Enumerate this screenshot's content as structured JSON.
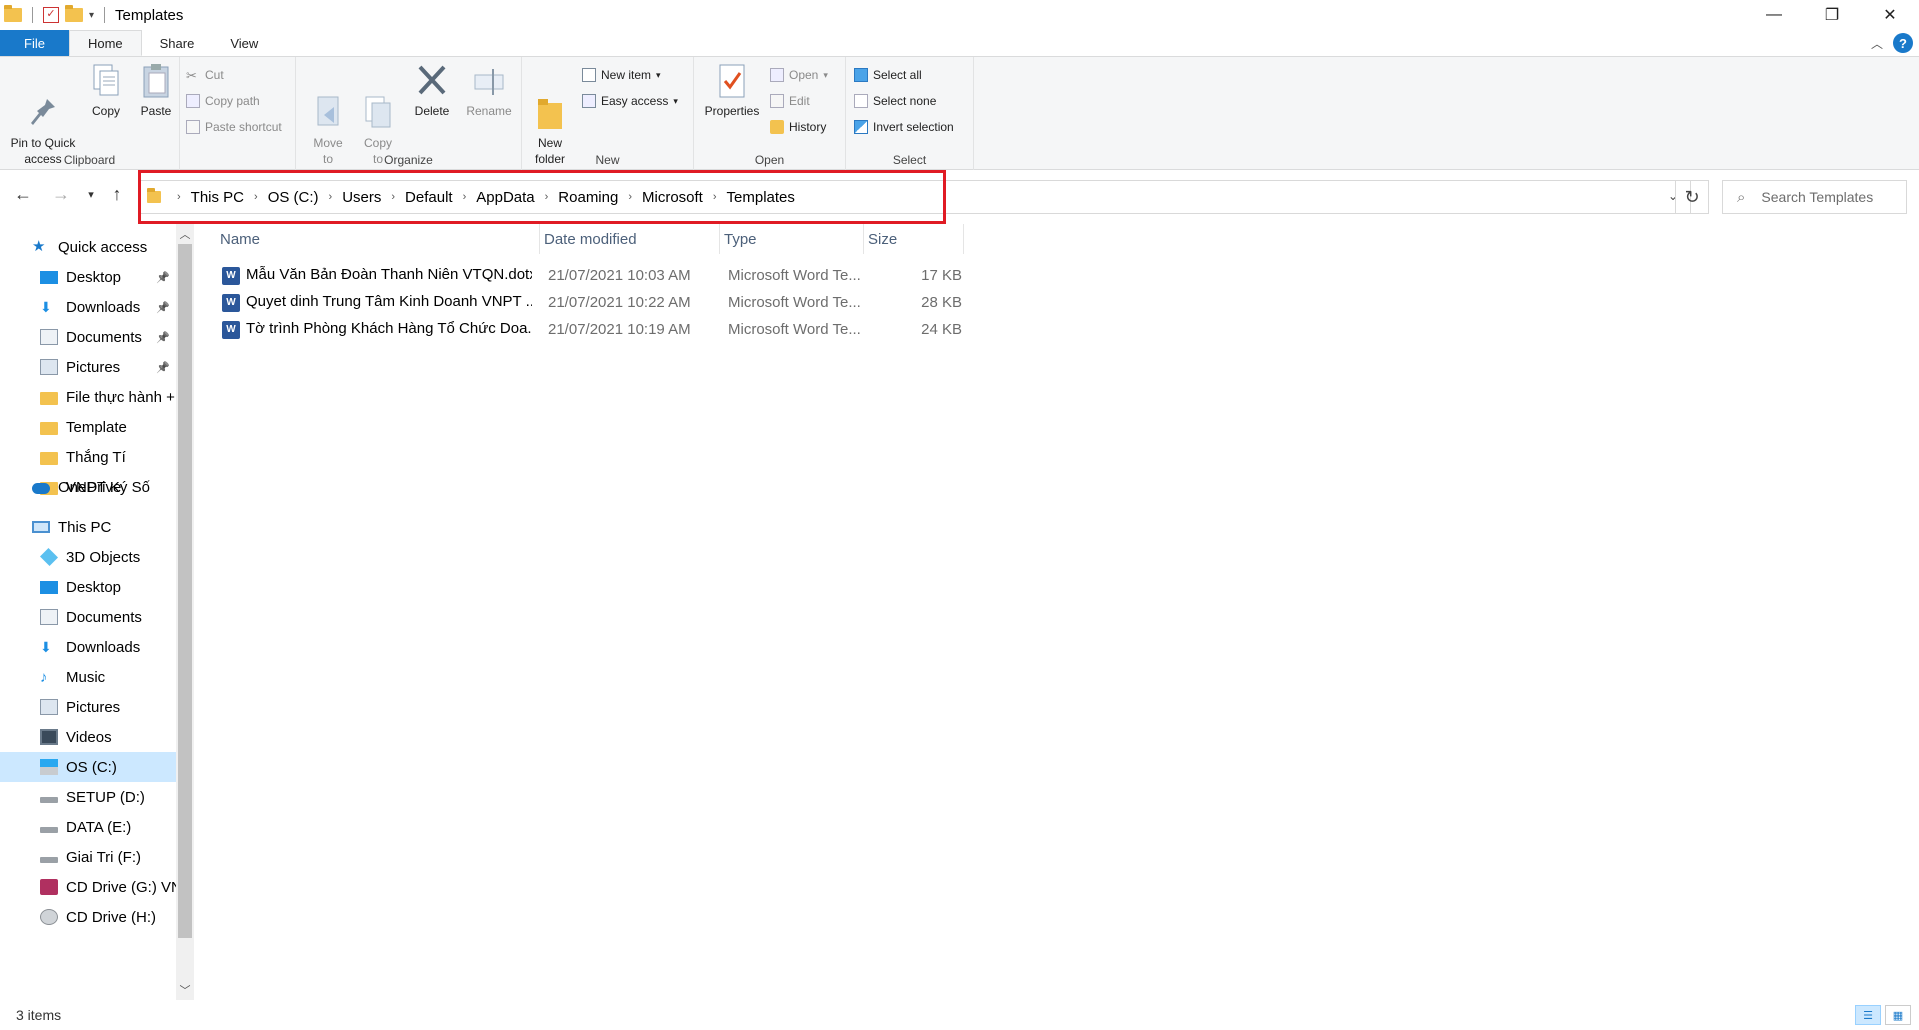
{
  "window": {
    "title": "Templates"
  },
  "ribbon_tabs": [
    "File",
    "Home",
    "Share",
    "View"
  ],
  "ribbon": {
    "clipboard": {
      "label": "Clipboard",
      "pin": "Pin to Quick\naccess",
      "copy": "Copy",
      "paste": "Paste",
      "cut": "Cut",
      "copy_path": "Copy path",
      "paste_shortcut": "Paste shortcut"
    },
    "organize": {
      "label": "Organize",
      "move_to": "Move\nto",
      "copy_to": "Copy\nto",
      "delete": "Delete",
      "rename": "Rename"
    },
    "new": {
      "label": "New",
      "new_folder": "New\nfolder",
      "new_item": "New item",
      "easy_access": "Easy access"
    },
    "open": {
      "label": "Open",
      "properties": "Properties",
      "open": "Open",
      "edit": "Edit",
      "history": "History"
    },
    "select": {
      "label": "Select",
      "select_all": "Select all",
      "select_none": "Select none",
      "invert_selection": "Invert selection"
    }
  },
  "address": {
    "crumbs": [
      "This PC",
      "OS (C:)",
      "Users",
      "Default",
      "AppData",
      "Roaming",
      "Microsoft",
      "Templates"
    ],
    "search_placeholder": "Search Templates"
  },
  "navpane": {
    "quick_access": "Quick access",
    "quick_items": [
      "Desktop",
      "Downloads",
      "Documents",
      "Pictures",
      "File thực hành +",
      "Template",
      "Thắng Tí",
      "VNPT Ký Số"
    ],
    "onedrive": "OneDrive",
    "this_pc": "This PC",
    "pc_items": [
      "3D Objects",
      "Desktop",
      "Documents",
      "Downloads",
      "Music",
      "Pictures",
      "Videos",
      "OS (C:)",
      "SETUP (D:)",
      "DATA (E:)",
      "Giai Tri (F:)",
      "CD Drive (G:) VN",
      "CD Drive (H:)"
    ]
  },
  "columns": {
    "name": "Name",
    "date": "Date modified",
    "type": "Type",
    "size": "Size"
  },
  "files": [
    {
      "name": "Mẫu Văn Bản Đoàn Thanh Niên VTQN.dotx",
      "date": "21/07/2021 10:03 AM",
      "type": "Microsoft Word Te...",
      "size": "17 KB"
    },
    {
      "name": "Quyet dinh Trung Tâm Kinh Doanh VNPT ...",
      "date": "21/07/2021 10:22 AM",
      "type": "Microsoft Word Te...",
      "size": "28 KB"
    },
    {
      "name": "Tờ trình Phòng Khách Hàng Tổ Chức Doa...",
      "date": "21/07/2021 10:19 AM",
      "type": "Microsoft Word Te...",
      "size": "24 KB"
    }
  ],
  "status": {
    "count": "3 items"
  },
  "colors": {
    "accent": "#1979ca",
    "highlight_box": "#e01b24",
    "selection": "#cce8ff"
  }
}
